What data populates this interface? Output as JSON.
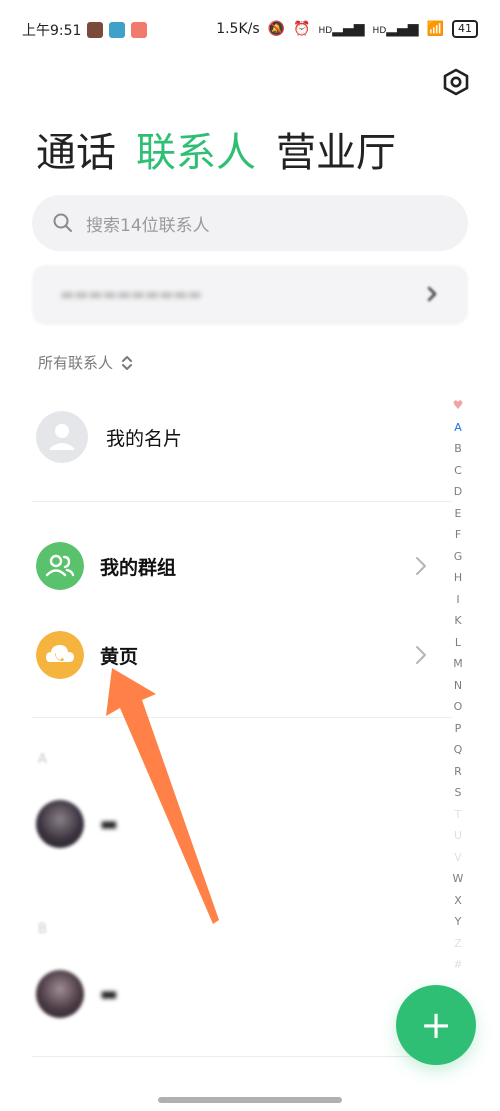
{
  "status_bar": {
    "time": "上午9:51",
    "net_speed": "1.5K/s",
    "hd_label_1": "HD",
    "hd_label_2": "HD",
    "battery": "41"
  },
  "settings_icon": "hexagon-settings-icon",
  "tabs": [
    "通话",
    "联系人",
    "营业厅"
  ],
  "active_tab": "联系人",
  "search": {
    "placeholder": "搜索14位联系人"
  },
  "filter": {
    "label": "所有联系人"
  },
  "rows": {
    "my_card": "我的名片",
    "my_groups": "我的群组",
    "yellow_pages": "黄页"
  },
  "sections": [
    "A",
    "B"
  ],
  "index": [
    "A",
    "B",
    "C",
    "D",
    "E",
    "F",
    "G",
    "H",
    "I",
    "K",
    "L",
    "M",
    "N",
    "O",
    "P",
    "Q",
    "R",
    "S",
    "T",
    "U",
    "V",
    "W",
    "X",
    "Y",
    "Z",
    "#"
  ],
  "colors": {
    "accent": "#2fbf74",
    "group_icon_bg": "#5ac26c",
    "yellow_icon_bg": "#f5b43d",
    "arrow": "#ff7a3d"
  }
}
